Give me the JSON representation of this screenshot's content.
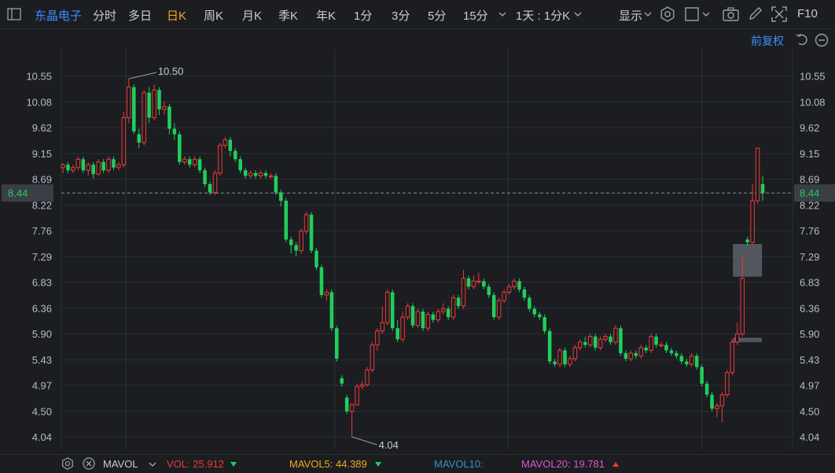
{
  "toolbar": {
    "stock_name": "东晶电子",
    "periods": [
      "分时",
      "多日",
      "日K",
      "周K",
      "月K",
      "季K",
      "年K",
      "1分",
      "3分",
      "5分",
      "15分"
    ],
    "active_period": "日K",
    "interval_select": "1天 : 1分K",
    "display_label": "显示",
    "f10_label": "F10"
  },
  "subtitle": "前复权",
  "icons": {
    "sidebar": "panel-toggle-icon",
    "chevron": "chevron-down-icon",
    "settings": "gear-icon",
    "square": "square-icon",
    "camera": "camera-icon",
    "draw": "pencil-icon",
    "fullscreen": "fullscreen-icon",
    "undo": "undo-icon",
    "more": "circle-minus-icon"
  },
  "chart_data": {
    "type": "candlestick",
    "y_ticks": [
      10.55,
      10.08,
      9.62,
      9.15,
      8.69,
      8.22,
      7.76,
      7.29,
      6.83,
      6.36,
      5.9,
      5.43,
      4.97,
      4.5,
      4.04
    ],
    "ylim": [
      3.8,
      10.9
    ],
    "current_price": 8.44,
    "current_price_label": "8.44",
    "max_label": "10.50",
    "min_label": "4.04",
    "colors": {
      "up": "#ee3a3a",
      "down": "#1fcf5a",
      "last": "#8fa7c7"
    },
    "candles": [
      [
        8.9,
        8.95,
        8.8,
        8.98
      ],
      [
        8.95,
        8.85,
        8.8,
        9.0
      ],
      [
        8.85,
        8.9,
        8.8,
        8.95
      ],
      [
        8.9,
        9.05,
        8.85,
        9.1
      ],
      [
        9.05,
        8.85,
        8.8,
        9.1
      ],
      [
        8.85,
        8.95,
        8.75,
        9.0
      ],
      [
        8.95,
        8.78,
        8.7,
        9.0
      ],
      [
        8.78,
        9.0,
        8.75,
        9.05
      ],
      [
        9.0,
        8.85,
        8.8,
        9.05
      ],
      [
        8.85,
        9.05,
        8.8,
        9.1
      ],
      [
        9.05,
        8.9,
        8.85,
        9.1
      ],
      [
        8.9,
        8.95,
        8.85,
        9.0
      ],
      [
        8.95,
        9.8,
        8.9,
        9.9
      ],
      [
        9.8,
        10.35,
        9.7,
        10.5
      ],
      [
        10.35,
        9.55,
        9.5,
        10.4
      ],
      [
        9.5,
        9.35,
        9.25,
        9.6
      ],
      [
        9.35,
        10.25,
        9.3,
        10.3
      ],
      [
        10.25,
        9.8,
        9.7,
        10.35
      ],
      [
        9.8,
        10.3,
        9.75,
        10.4
      ],
      [
        10.3,
        9.95,
        9.85,
        10.35
      ],
      [
        9.95,
        10.0,
        9.85,
        10.1
      ],
      [
        10.0,
        9.6,
        9.5,
        10.05
      ],
      [
        9.6,
        9.5,
        9.4,
        9.7
      ],
      [
        9.5,
        9.0,
        8.95,
        9.55
      ],
      [
        9.0,
        9.05,
        8.95,
        9.1
      ],
      [
        9.05,
        8.95,
        8.9,
        9.1
      ],
      [
        8.95,
        9.05,
        8.9,
        9.1
      ],
      [
        9.05,
        8.85,
        8.8,
        9.1
      ],
      [
        8.85,
        8.6,
        8.55,
        8.9
      ],
      [
        8.6,
        8.45,
        8.4,
        8.65
      ],
      [
        8.45,
        8.8,
        8.4,
        8.85
      ],
      [
        8.8,
        9.3,
        8.75,
        9.35
      ],
      [
        9.3,
        9.4,
        9.25,
        9.45
      ],
      [
        9.4,
        9.2,
        9.1,
        9.45
      ],
      [
        9.2,
        9.05,
        9.0,
        9.25
      ],
      [
        9.05,
        8.85,
        8.8,
        9.1
      ],
      [
        8.85,
        8.75,
        8.7,
        8.9
      ],
      [
        8.75,
        8.8,
        8.7,
        8.85
      ],
      [
        8.8,
        8.75,
        8.7,
        8.85
      ],
      [
        8.75,
        8.8,
        8.7,
        8.85
      ],
      [
        8.8,
        8.75,
        8.7,
        8.85
      ],
      [
        8.75,
        8.75,
        8.7,
        8.8
      ],
      [
        8.75,
        8.45,
        8.4,
        8.8
      ],
      [
        8.45,
        8.3,
        8.2,
        8.5
      ],
      [
        8.3,
        7.6,
        7.55,
        8.35
      ],
      [
        7.6,
        7.5,
        7.35,
        7.65
      ],
      [
        7.5,
        7.4,
        7.3,
        7.55
      ],
      [
        7.4,
        7.75,
        7.35,
        7.8
      ],
      [
        7.75,
        8.05,
        7.7,
        8.1
      ],
      [
        8.05,
        7.4,
        7.35,
        8.1
      ],
      [
        7.4,
        7.1,
        7.05,
        7.45
      ],
      [
        7.1,
        6.6,
        6.55,
        7.15
      ],
      [
        6.6,
        6.65,
        6.5,
        6.7
      ],
      [
        6.65,
        6.0,
        5.95,
        6.7
      ],
      [
        6.0,
        5.45,
        5.4,
        6.05
      ],
      [
        5.1,
        5.0,
        4.95,
        5.15
      ],
      [
        4.75,
        4.5,
        4.45,
        4.8
      ],
      [
        4.5,
        4.62,
        4.04,
        4.65
      ],
      [
        4.62,
        4.95,
        4.6,
        5.0
      ],
      [
        4.95,
        4.98,
        4.9,
        5.05
      ],
      [
        4.98,
        5.25,
        4.95,
        5.3
      ],
      [
        5.25,
        5.7,
        5.2,
        5.75
      ],
      [
        5.7,
        5.95,
        5.6,
        6.0
      ],
      [
        5.95,
        6.1,
        5.9,
        6.4
      ],
      [
        6.1,
        6.65,
        6.05,
        6.7
      ],
      [
        6.65,
        6.0,
        5.95,
        6.7
      ],
      [
        6.0,
        5.8,
        5.75,
        6.15
      ],
      [
        5.8,
        6.2,
        5.75,
        6.3
      ],
      [
        6.2,
        6.4,
        6.15,
        6.45
      ],
      [
        6.4,
        6.05,
        6.0,
        6.45
      ],
      [
        6.05,
        6.3,
        6.0,
        6.35
      ],
      [
        6.3,
        6.0,
        5.95,
        6.35
      ],
      [
        6.0,
        6.25,
        5.95,
        6.3
      ],
      [
        6.25,
        6.15,
        6.1,
        6.3
      ],
      [
        6.15,
        6.3,
        6.1,
        6.35
      ],
      [
        6.3,
        6.35,
        6.25,
        6.45
      ],
      [
        6.35,
        6.2,
        6.15,
        6.4
      ],
      [
        6.2,
        6.55,
        6.15,
        6.6
      ],
      [
        6.55,
        6.4,
        6.35,
        6.6
      ],
      [
        6.4,
        6.9,
        6.35,
        7.05
      ],
      [
        6.9,
        6.75,
        6.7,
        6.95
      ],
      [
        6.75,
        6.85,
        6.7,
        6.95
      ],
      [
        6.85,
        6.85,
        6.8,
        7.0
      ],
      [
        6.85,
        6.75,
        6.7,
        6.9
      ],
      [
        6.75,
        6.6,
        6.55,
        6.8
      ],
      [
        6.6,
        6.2,
        6.15,
        6.65
      ],
      [
        6.2,
        6.5,
        6.15,
        6.55
      ],
      [
        6.5,
        6.65,
        6.45,
        6.7
      ],
      [
        6.65,
        6.75,
        6.6,
        6.8
      ],
      [
        6.75,
        6.85,
        6.7,
        6.9
      ],
      [
        6.85,
        6.7,
        6.65,
        6.9
      ],
      [
        6.7,
        6.55,
        6.5,
        6.75
      ],
      [
        6.55,
        6.35,
        6.3,
        6.6
      ],
      [
        6.35,
        6.25,
        6.2,
        6.4
      ],
      [
        6.25,
        6.2,
        6.15,
        6.3
      ],
      [
        6.2,
        5.95,
        5.9,
        6.25
      ],
      [
        5.95,
        5.4,
        5.35,
        6.0
      ],
      [
        5.4,
        5.35,
        5.3,
        5.45
      ],
      [
        5.35,
        5.6,
        5.3,
        5.65
      ],
      [
        5.6,
        5.35,
        5.3,
        5.65
      ],
      [
        5.35,
        5.45,
        5.3,
        5.5
      ],
      [
        5.45,
        5.65,
        5.4,
        5.7
      ],
      [
        5.65,
        5.75,
        5.6,
        5.8
      ],
      [
        5.75,
        5.7,
        5.65,
        5.85
      ],
      [
        5.7,
        5.85,
        5.65,
        5.9
      ],
      [
        5.85,
        5.65,
        5.6,
        5.9
      ],
      [
        5.65,
        5.8,
        5.6,
        5.85
      ],
      [
        5.8,
        5.85,
        5.75,
        5.9
      ],
      [
        5.85,
        5.75,
        5.7,
        5.9
      ],
      [
        5.75,
        6.0,
        5.7,
        6.05
      ],
      [
        6.0,
        5.55,
        5.5,
        6.05
      ],
      [
        5.55,
        5.45,
        5.4,
        5.6
      ],
      [
        5.45,
        5.55,
        5.4,
        5.6
      ],
      [
        5.55,
        5.5,
        5.45,
        5.6
      ],
      [
        5.5,
        5.65,
        5.45,
        5.7
      ],
      [
        5.65,
        5.6,
        5.55,
        5.7
      ],
      [
        5.6,
        5.85,
        5.55,
        5.9
      ],
      [
        5.85,
        5.7,
        5.65,
        5.9
      ],
      [
        5.7,
        5.7,
        5.65,
        5.75
      ],
      [
        5.7,
        5.6,
        5.55,
        5.75
      ],
      [
        5.6,
        5.55,
        5.5,
        5.65
      ],
      [
        5.55,
        5.5,
        5.45,
        5.6
      ],
      [
        5.5,
        5.4,
        5.35,
        5.55
      ],
      [
        5.4,
        5.35,
        5.3,
        5.45
      ],
      [
        5.35,
        5.5,
        5.3,
        5.55
      ],
      [
        5.5,
        5.3,
        5.25,
        5.55
      ],
      [
        5.3,
        5.0,
        4.95,
        5.35
      ],
      [
        5.0,
        4.8,
        4.75,
        5.05
      ],
      [
        4.8,
        4.55,
        4.5,
        4.85
      ],
      [
        4.55,
        4.6,
        4.4,
        4.65
      ],
      [
        4.6,
        4.8,
        4.3,
        4.85
      ],
      [
        4.8,
        5.2,
        4.75,
        5.25
      ],
      [
        5.2,
        5.75,
        5.15,
        5.8
      ],
      [
        5.75,
        5.9,
        5.7,
        6.1
      ],
      [
        5.9,
        6.9,
        5.85,
        7.3
      ],
      [
        7.6,
        7.55,
        7.5,
        7.65
      ],
      [
        7.55,
        8.3,
        7.5,
        8.6
      ],
      [
        8.3,
        9.25,
        8.25,
        9.25
      ],
      [
        8.6,
        8.44,
        8.3,
        8.75
      ]
    ]
  },
  "overlays": [
    {
      "name": "mask-block-large",
      "top": 7.52,
      "bottom": 6.93
    },
    {
      "name": "mask-block-small",
      "top": 5.83,
      "bottom": 5.75
    }
  ],
  "footer": {
    "indicator": "MAVOL",
    "vol_label": "VOL: 25.912",
    "vol_color": "#ee3a3a",
    "mavol5_label": "MAVOL5: 44.389",
    "mavol5_color": "#f5a623",
    "mavol10_label": "MAVOL10:",
    "mavol10_color": "#3f8fbf",
    "mavol20_label": "MAVOL20: 19.781",
    "mavol20_color": "#e056cf"
  }
}
